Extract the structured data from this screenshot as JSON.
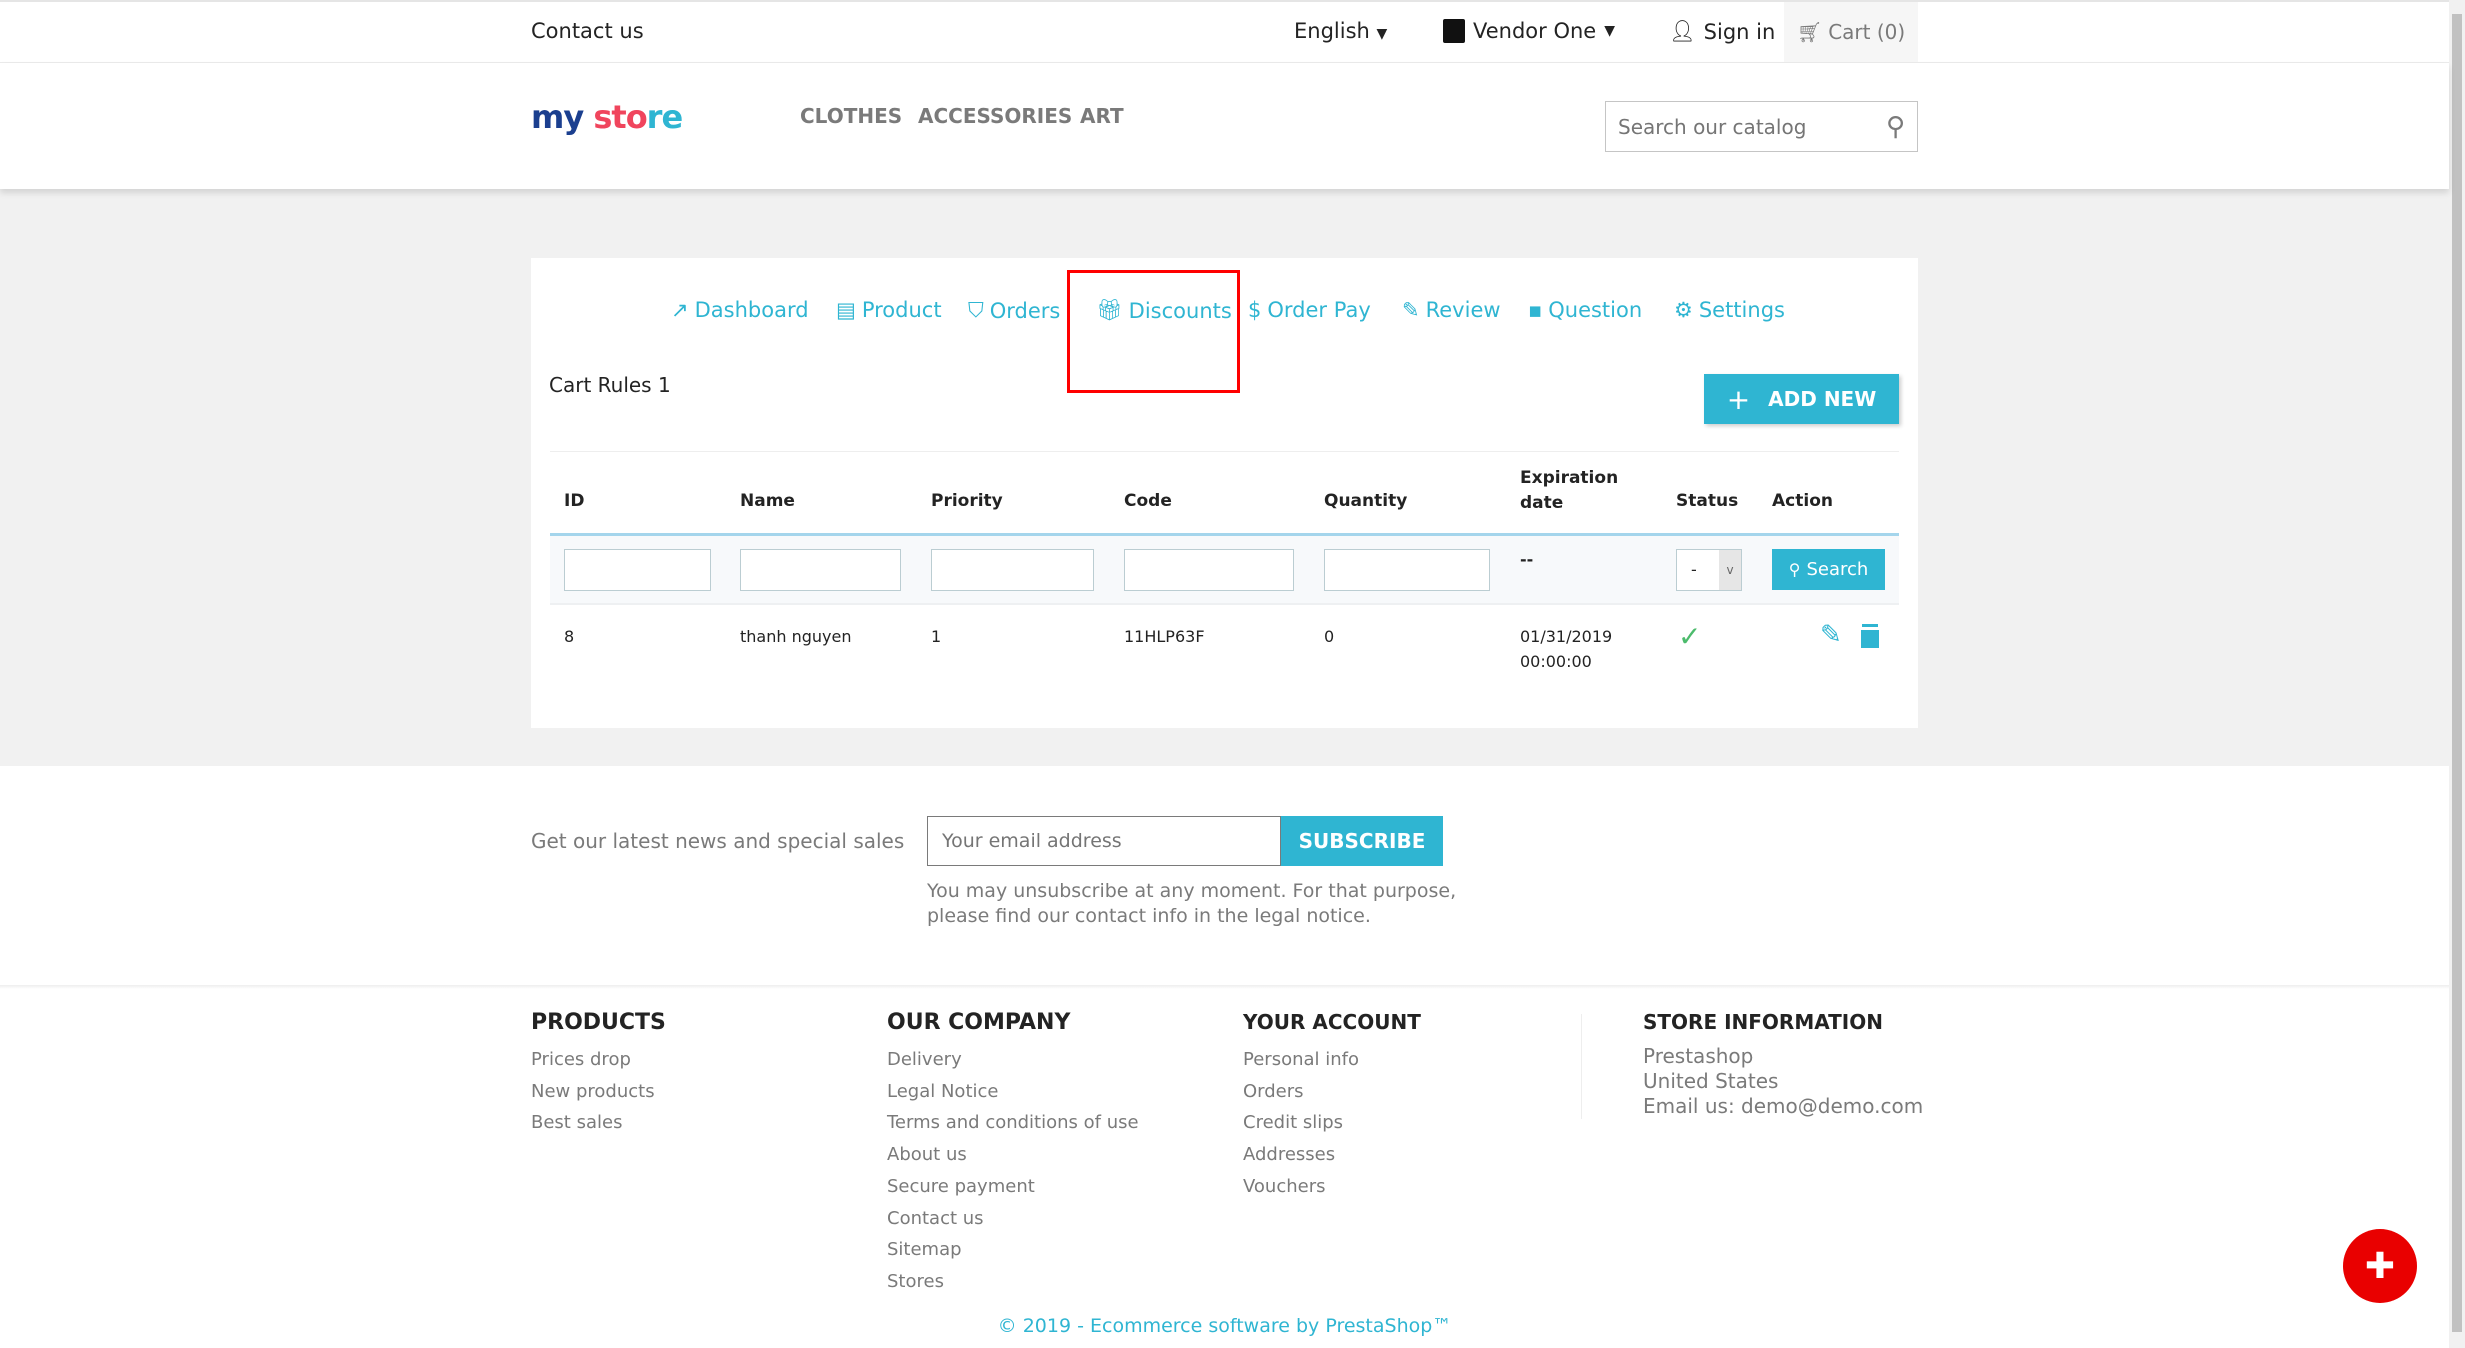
{
  "topbar": {
    "contact": "Contact us",
    "language": "English",
    "vendor": "Vendor One",
    "signin": "Sign in",
    "cart": "Cart (0)"
  },
  "header": {
    "logo": "my store",
    "nav": [
      "CLOTHES",
      "ACCESSORIES",
      "ART"
    ],
    "search_placeholder": "Search our catalog"
  },
  "tabs": [
    {
      "label": "Dashboard",
      "icon": "trend-icon"
    },
    {
      "label": "Product",
      "icon": "store-icon"
    },
    {
      "label": "Orders",
      "icon": "basket-icon"
    },
    {
      "label": "Discounts",
      "icon": "gift-icon",
      "active": true
    },
    {
      "label": "Order Pay",
      "icon": "dollar-icon"
    },
    {
      "label": "Review",
      "icon": "review-icon"
    },
    {
      "label": "Question",
      "icon": "chat-icon"
    },
    {
      "label": "Settings",
      "icon": "gear-icon"
    }
  ],
  "cart_rules": {
    "title": "Cart Rules 1",
    "add_new": "ADD NEW",
    "columns": [
      "ID",
      "Name",
      "Priority",
      "Code",
      "Quantity",
      "Expiration date",
      "Status",
      "Action"
    ],
    "filter": {
      "expiration": "--",
      "status": "-",
      "search": "Search"
    },
    "rows": [
      {
        "id": "8",
        "name": "thanh nguyen",
        "priority": "1",
        "code": "11HLP63F",
        "quantity": "0",
        "expiration_date": "01/31/2019",
        "expiration_time": "00:00:00",
        "status": "enabled"
      }
    ]
  },
  "newsletter": {
    "label": "Get our latest news and special sales",
    "placeholder": "Your email address",
    "button": "SUBSCRIBE",
    "note1": "You may unsubscribe at any moment. For that purpose,",
    "note2": "please find our contact info in the legal notice."
  },
  "footer": {
    "products": {
      "title": "PRODUCTS",
      "links": [
        "Prices drop",
        "New products",
        "Best sales"
      ]
    },
    "company": {
      "title": "OUR COMPANY",
      "links": [
        "Delivery",
        "Legal Notice",
        "Terms and conditions of use",
        "About us",
        "Secure payment",
        "Contact us",
        "Sitemap",
        "Stores"
      ]
    },
    "account": {
      "title": "YOUR ACCOUNT",
      "links": [
        "Personal info",
        "Orders",
        "Credit slips",
        "Addresses",
        "Vouchers"
      ]
    },
    "store": {
      "title": "STORE INFORMATION",
      "lines": [
        "Prestashop",
        "United States",
        "Email us: demo@demo.com"
      ]
    },
    "copyright": "© 2019 - Ecommerce software by PrestaShop™"
  },
  "colors": {
    "accent": "#2fb5d2",
    "highlight": "#ff0000",
    "status_ok": "#4cbb6c",
    "chat": "#e90000"
  }
}
